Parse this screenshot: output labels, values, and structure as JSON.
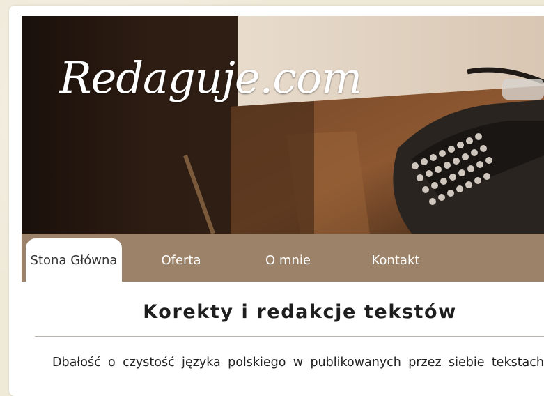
{
  "site": {
    "logo_text": "Redaguje.com"
  },
  "nav": {
    "items": [
      {
        "label": "Stona Główna",
        "active": true
      },
      {
        "label": "Oferta",
        "active": false
      },
      {
        "label": "O mnie",
        "active": false
      },
      {
        "label": "Kontakt",
        "active": false
      }
    ]
  },
  "content": {
    "title": "Korekty i redakcje tekstów",
    "paragraph": "Dbałość o czystość języka polskiego w publikowanych przez siebie tekstach"
  },
  "colors": {
    "nav_background": "#9b8268",
    "page_background": "#efe9d8",
    "card_background": "#ffffff"
  }
}
